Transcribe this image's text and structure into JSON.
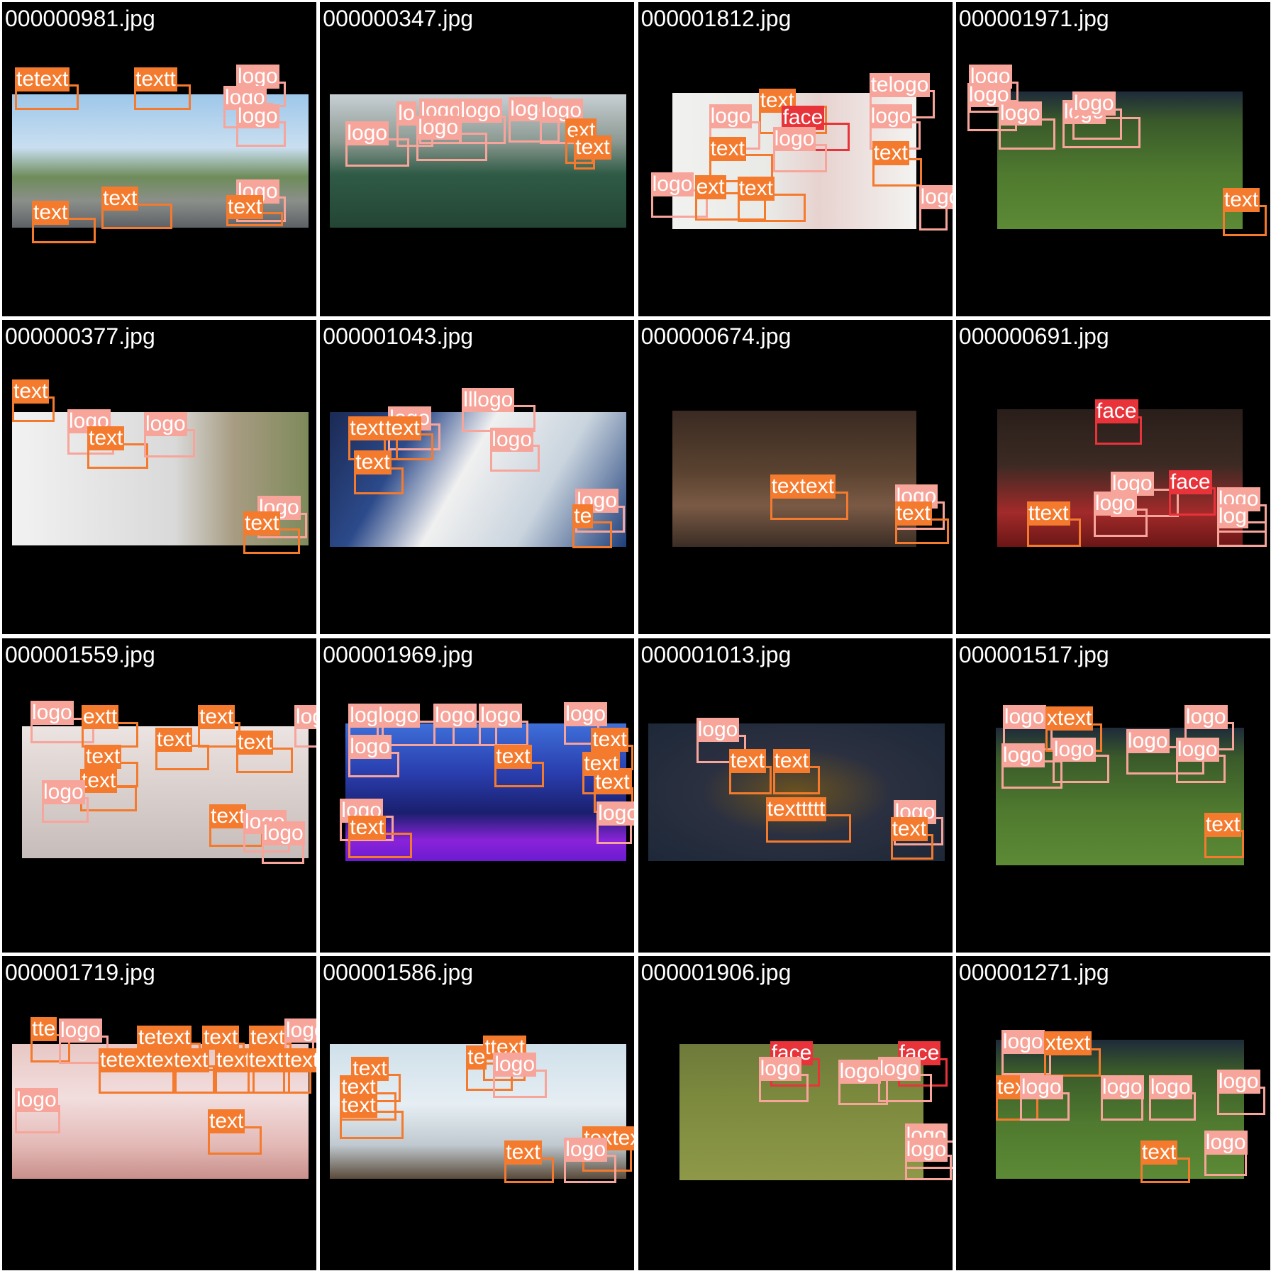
{
  "page": {
    "label_colors": {
      "text": "#f47a2e",
      "logo": "#f7a59b",
      "face": "#e8333a"
    },
    "grid_line_color": "#ffffff",
    "cell_background": "#000000"
  },
  "cells": [
    {
      "filename": "000000981.jpg",
      "scene": "game-sky",
      "detections": [
        {
          "label": "text",
          "text": "tetext"
        },
        {
          "label": "text",
          "text": "textt"
        },
        {
          "label": "logo",
          "text": "logo"
        },
        {
          "label": "logo",
          "text": "logo"
        },
        {
          "label": "logo",
          "text": "logo"
        },
        {
          "label": "text",
          "text": "text"
        },
        {
          "label": "text",
          "text": "text"
        },
        {
          "label": "logo",
          "text": "logo"
        },
        {
          "label": "text",
          "text": "text"
        }
      ]
    },
    {
      "filename": "000000347.jpg",
      "scene": "futsal",
      "detections": [
        {
          "label": "logo",
          "text": "lo"
        },
        {
          "label": "logo",
          "text": "logo"
        },
        {
          "label": "logo",
          "text": "logo"
        },
        {
          "label": "logo",
          "text": "logo"
        },
        {
          "label": "logo",
          "text": "logo"
        },
        {
          "label": "logo",
          "text": "logo"
        },
        {
          "label": "logo",
          "text": "logo"
        },
        {
          "label": "text",
          "text": "ext"
        },
        {
          "label": "text",
          "text": "text"
        }
      ]
    },
    {
      "filename": "000001812.jpg",
      "scene": "jersey",
      "detections": [
        {
          "label": "text",
          "text": "text"
        },
        {
          "label": "face",
          "text": "face"
        },
        {
          "label": "logo",
          "text": "logo"
        },
        {
          "label": "logo",
          "text": "logo"
        },
        {
          "label": "logo",
          "text": "telogo"
        },
        {
          "label": "logo",
          "text": "logo"
        },
        {
          "label": "text",
          "text": "text"
        },
        {
          "label": "text",
          "text": "text"
        },
        {
          "label": "logo",
          "text": "logo"
        },
        {
          "label": "text",
          "text": "ext"
        },
        {
          "label": "text",
          "text": "text"
        },
        {
          "label": "logo",
          "text": "logo"
        }
      ]
    },
    {
      "filename": "000001971.jpg",
      "scene": "soccer-field",
      "detections": [
        {
          "label": "logo",
          "text": "logo"
        },
        {
          "label": "logo",
          "text": "logo"
        },
        {
          "label": "logo",
          "text": "logo"
        },
        {
          "label": "logo",
          "text": "logo"
        },
        {
          "label": "logo",
          "text": "logo"
        },
        {
          "label": "text",
          "text": "text"
        }
      ]
    },
    {
      "filename": "000000377.jpg",
      "scene": "car",
      "detections": [
        {
          "label": "text",
          "text": "text"
        },
        {
          "label": "logo",
          "text": "logo"
        },
        {
          "label": "text",
          "text": "text"
        },
        {
          "label": "logo",
          "text": "logo"
        },
        {
          "label": "logo",
          "text": "logo"
        },
        {
          "label": "text",
          "text": "text"
        }
      ]
    },
    {
      "filename": "000001043.jpg",
      "scene": "shooter-room",
      "detections": [
        {
          "label": "logo",
          "text": "logo"
        },
        {
          "label": "logo",
          "text": "lllogo"
        },
        {
          "label": "text",
          "text": "text"
        },
        {
          "label": "text",
          "text": "text"
        },
        {
          "label": "logo",
          "text": "logo"
        },
        {
          "label": "text",
          "text": "text"
        },
        {
          "label": "logo",
          "text": "logo"
        },
        {
          "label": "text",
          "text": "te"
        }
      ]
    },
    {
      "filename": "000000674.jpg",
      "scene": "bedroom",
      "detections": [
        {
          "label": "text",
          "text": "textext"
        },
        {
          "label": "logo",
          "text": "logo"
        },
        {
          "label": "text",
          "text": "text"
        }
      ]
    },
    {
      "filename": "000000691.jpg",
      "scene": "soccer-crowd",
      "detections": [
        {
          "label": "face",
          "text": "face"
        },
        {
          "label": "logo",
          "text": "logo"
        },
        {
          "label": "face",
          "text": "face"
        },
        {
          "label": "logo",
          "text": "logo"
        },
        {
          "label": "text",
          "text": "ttext"
        },
        {
          "label": "logo",
          "text": "logo"
        },
        {
          "label": "logo",
          "text": "log"
        }
      ]
    },
    {
      "filename": "000001559.jpg",
      "scene": "obby",
      "detections": [
        {
          "label": "logo",
          "text": "logo"
        },
        {
          "label": "text",
          "text": "extt"
        },
        {
          "label": "text",
          "text": "text"
        },
        {
          "label": "logo",
          "text": "logo"
        },
        {
          "label": "text",
          "text": "text"
        },
        {
          "label": "text",
          "text": "text"
        },
        {
          "label": "text",
          "text": "text"
        },
        {
          "label": "text",
          "text": "text"
        },
        {
          "label": "logo",
          "text": "logo"
        },
        {
          "label": "text",
          "text": "text"
        },
        {
          "label": "logo",
          "text": "logo"
        },
        {
          "label": "logo",
          "text": "logo"
        }
      ]
    },
    {
      "filename": "000001969.jpg",
      "scene": "purple-game",
      "detections": [
        {
          "label": "logo",
          "text": "logo"
        },
        {
          "label": "logo",
          "text": "logo"
        },
        {
          "label": "logo",
          "text": "logo"
        },
        {
          "label": "logo",
          "text": "logo"
        },
        {
          "label": "logo",
          "text": "logo"
        },
        {
          "label": "text",
          "text": "text"
        },
        {
          "label": "logo",
          "text": "logo"
        },
        {
          "label": "text",
          "text": "text"
        },
        {
          "label": "text",
          "text": "text"
        },
        {
          "label": "text",
          "text": "text"
        },
        {
          "label": "logo",
          "text": "logo"
        },
        {
          "label": "logo",
          "text": "logo"
        },
        {
          "label": "text",
          "text": "text"
        }
      ]
    },
    {
      "filename": "000001013.jpg",
      "scene": "victory",
      "detections": [
        {
          "label": "logo",
          "text": "logo"
        },
        {
          "label": "text",
          "text": "text"
        },
        {
          "label": "text",
          "text": "text"
        },
        {
          "label": "text",
          "text": "texttttt"
        },
        {
          "label": "logo",
          "text": "logo"
        },
        {
          "label": "text",
          "text": "text"
        }
      ]
    },
    {
      "filename": "000001517.jpg",
      "scene": "soccer-field",
      "detections": [
        {
          "label": "logo",
          "text": "logo"
        },
        {
          "label": "text",
          "text": "xtext"
        },
        {
          "label": "logo",
          "text": "logo"
        },
        {
          "label": "logo",
          "text": "logo"
        },
        {
          "label": "logo",
          "text": "logo"
        },
        {
          "label": "logo",
          "text": "logo"
        },
        {
          "label": "logo",
          "text": "logo"
        },
        {
          "label": "text",
          "text": "text"
        }
      ]
    },
    {
      "filename": "000001719.jpg",
      "scene": "cartoon",
      "detections": [
        {
          "label": "text",
          "text": "tte"
        },
        {
          "label": "logo",
          "text": "logo"
        },
        {
          "label": "text",
          "text": "tetext"
        },
        {
          "label": "text",
          "text": "text"
        },
        {
          "label": "text",
          "text": "text"
        },
        {
          "label": "logo",
          "text": "logo"
        },
        {
          "label": "text",
          "text": "tetextext"
        },
        {
          "label": "text",
          "text": "text"
        },
        {
          "label": "text",
          "text": "text"
        },
        {
          "label": "text",
          "text": "text"
        },
        {
          "label": "text",
          "text": "text"
        },
        {
          "label": "logo",
          "text": "logo"
        },
        {
          "label": "text",
          "text": "text"
        }
      ]
    },
    {
      "filename": "000001586.jpg",
      "scene": "shooter-white",
      "detections": [
        {
          "label": "text",
          "text": "text"
        },
        {
          "label": "text",
          "text": "ttext"
        },
        {
          "label": "text",
          "text": "te"
        },
        {
          "label": "logo",
          "text": "logo"
        },
        {
          "label": "text",
          "text": "text"
        },
        {
          "label": "text",
          "text": "text"
        },
        {
          "label": "text",
          "text": "textext"
        },
        {
          "label": "logo",
          "text": "logo"
        },
        {
          "label": "text",
          "text": "text"
        }
      ]
    },
    {
      "filename": "000001906.jpg",
      "scene": "soccer-players",
      "detections": [
        {
          "label": "face",
          "text": "face"
        },
        {
          "label": "logo",
          "text": "logo"
        },
        {
          "label": "face",
          "text": "face"
        },
        {
          "label": "logo",
          "text": "logo"
        },
        {
          "label": "logo",
          "text": "logo"
        },
        {
          "label": "logo",
          "text": "logo"
        },
        {
          "label": "logo",
          "text": "logo"
        }
      ]
    },
    {
      "filename": "000001271.jpg",
      "scene": "soccer-field",
      "detections": [
        {
          "label": "logo",
          "text": "logo"
        },
        {
          "label": "text",
          "text": "xtext"
        },
        {
          "label": "text",
          "text": "tex"
        },
        {
          "label": "logo",
          "text": "logo"
        },
        {
          "label": "logo",
          "text": "logo"
        },
        {
          "label": "logo",
          "text": "logo"
        },
        {
          "label": "logo",
          "text": "logo"
        },
        {
          "label": "logo",
          "text": "logo"
        },
        {
          "label": "text",
          "text": "text"
        }
      ]
    }
  ]
}
